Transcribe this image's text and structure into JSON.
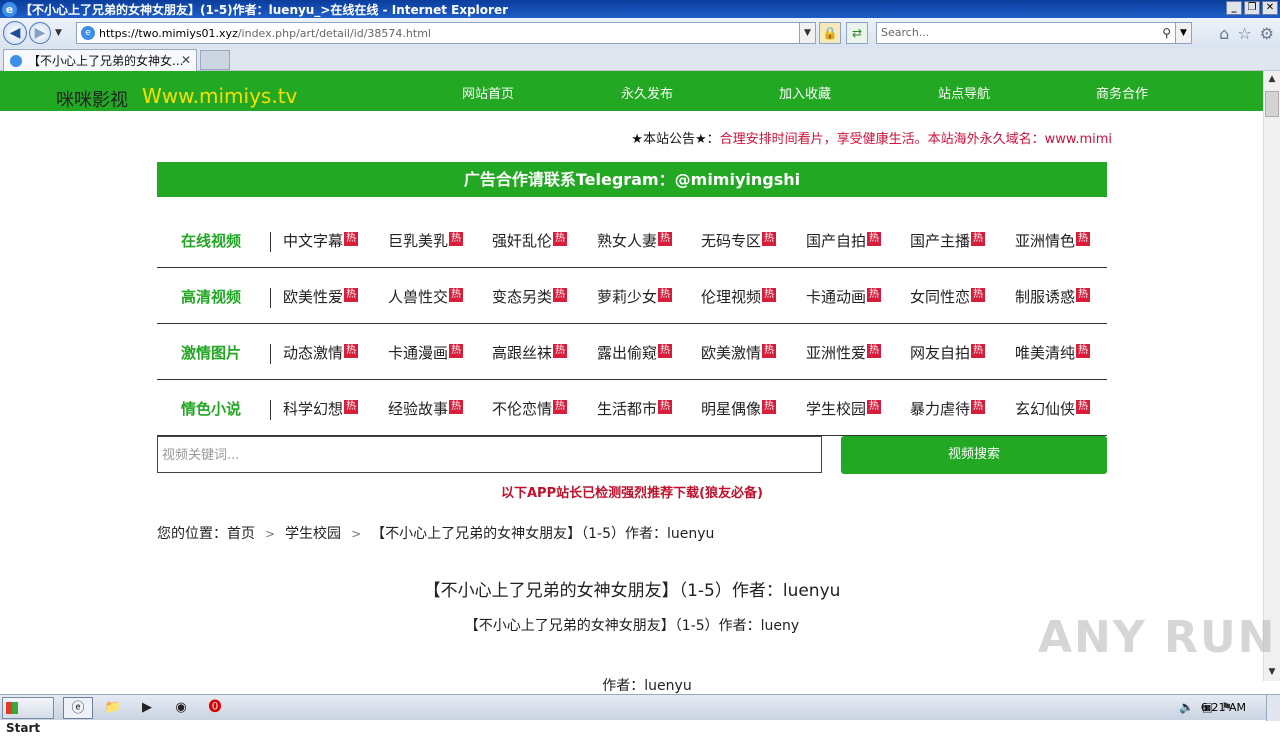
{
  "window": {
    "title": "【不小心上了兄弟的女神女朋友】(1-5)作者：luenyu_>在线在线 - Internet Explorer",
    "controls": [
      "_",
      "❐",
      "✕"
    ]
  },
  "browser": {
    "url_host": "https://two.mimiys01.xyz",
    "url_path": "/index.php/art/detail/id/38574.html",
    "search_placeholder": "Search...",
    "tab_title": "【不小心上了兄弟的女神女...",
    "tab_close": "✕"
  },
  "site": {
    "logo_cn": "咪咪影视",
    "logo_en": "Www.mimiys.tv",
    "nav": [
      "网站首页",
      "永久发布",
      "加入收藏",
      "站点导航",
      "商务合作"
    ],
    "notice_label": "★本站公告★：",
    "notice_text": "合理安排时间看片，享受健康生活。本站海外永久域名：www.mimi",
    "ad_banner": "广告合作请联系Telegram：@mimiyingshi",
    "hot_badge": "热",
    "categories": [
      {
        "title": "在线视频",
        "items": [
          "中文字幕",
          "巨乳美乳",
          "强奸乱伦",
          "熟女人妻",
          "无码专区",
          "国产自拍",
          "国产主播",
          "亚洲情色"
        ]
      },
      {
        "title": "高清视频",
        "items": [
          "欧美性爱",
          "人兽性交",
          "变态另类",
          "萝莉少女",
          "伦理视频",
          "卡通动画",
          "女同性恋",
          "制服诱惑"
        ]
      },
      {
        "title": "激情图片",
        "items": [
          "动态激情",
          "卡通漫画",
          "高跟丝袜",
          "露出偷窥",
          "欧美激情",
          "亚洲性爱",
          "网友自拍",
          "唯美清纯"
        ]
      },
      {
        "title": "情色小说",
        "items": [
          "科学幻想",
          "经验故事",
          "不伦恋情",
          "生活都市",
          "明星偶像",
          "学生校园",
          "暴力虐待",
          "玄幻仙侠"
        ]
      }
    ],
    "search_placeholder": "视频关键词...",
    "search_button": "视频搜索",
    "app_note": "以下APP站长已检测强烈推荐下载(狼友必备)",
    "breadcrumb": {
      "label": "您的位置：",
      "home": "首页",
      "category": "学生校园",
      "current": "【不小心上了兄弟的女神女朋友】（1-5）作者：luenyu"
    },
    "post_title": "【不小心上了兄弟的女神女朋友】（1-5）作者：luenyu",
    "post_subtitle": "【不小心上了兄弟的女神女朋友】（1-5）作者：lueny",
    "post_author": "作者：luenyu"
  },
  "watermark": "ANY RUN",
  "taskbar": {
    "start": "Start",
    "clock": "6:21 AM"
  },
  "colors": {
    "brand_green": "#22a822",
    "logo_yellow": "#f4e000",
    "accent_red": "#d61d3a"
  }
}
